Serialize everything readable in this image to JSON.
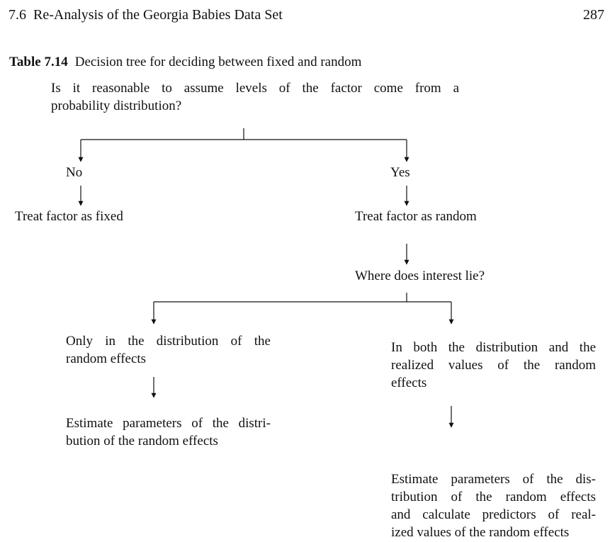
{
  "header": {
    "section": "7.6",
    "title": "Re-Analysis of the Georgia Babies Data Set",
    "page_number": "287"
  },
  "caption": {
    "label": "Table 7.14",
    "text": "Decision tree for deciding between fixed and random"
  },
  "tree": {
    "question": {
      "line1": "Is it reasonable to assume levels of the factor come from a",
      "line2": "probability distribution?"
    },
    "no": {
      "label": "No",
      "outcome": "Treat factor as fixed"
    },
    "yes": {
      "label": "Yes",
      "outcome": "Treat factor as random"
    },
    "interest_question": "Where does interest lie?",
    "left_branch": {
      "line1": "Only in the distribution of the",
      "line2": "random effects",
      "result_line1": "Estimate parameters of the distri-",
      "result_line2": "bution of the random effects"
    },
    "right_branch": {
      "line1": "In both the distribution and the",
      "line2": "realized values of the random",
      "line3": "effects",
      "result_line1": "Estimate parameters of the dis-",
      "result_line2": "tribution of the random effects",
      "result_line3": "and calculate predictors of real-",
      "result_line4": "ized values of the random effects"
    }
  }
}
